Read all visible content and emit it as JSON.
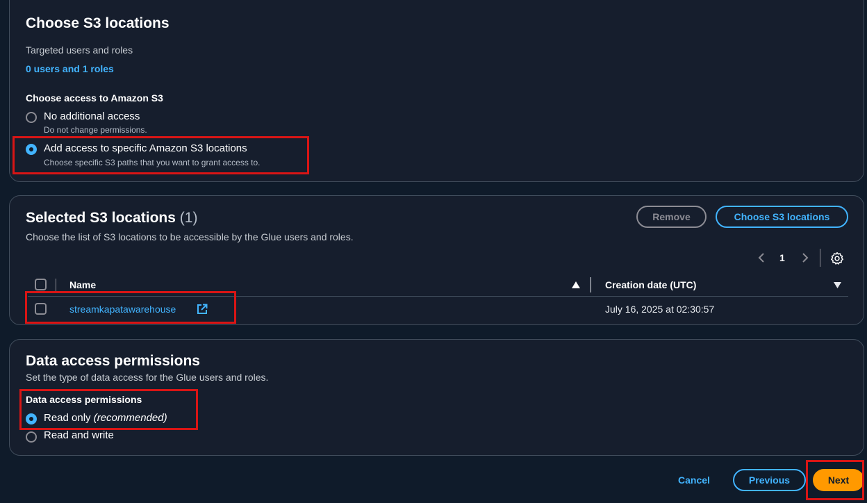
{
  "s3_access": {
    "title": "Choose S3 locations",
    "targeted_label": "Targeted users and roles",
    "targeted_link": "0 users and 1 roles",
    "access_label": "Choose access to Amazon S3",
    "options": [
      {
        "label": "No additional access",
        "description": "Do not change permissions.",
        "selected": false
      },
      {
        "label": "Add access to specific Amazon S3 locations",
        "description": "Choose specific S3 paths that you want to grant access to.",
        "selected": true
      }
    ]
  },
  "selected_locations": {
    "title": "Selected S3 locations",
    "count": "(1)",
    "description": "Choose the list of S3 locations to be accessible by the Glue users and roles.",
    "remove_label": "Remove",
    "choose_label": "Choose S3 locations",
    "pagination": {
      "current_page": "1"
    },
    "columns": {
      "name": "Name",
      "creation_date": "Creation date (UTC)"
    },
    "rows": [
      {
        "name": "streamkapatawarehouse",
        "creation_date": "July 16, 2025 at 02:30:57"
      }
    ]
  },
  "data_permissions": {
    "title": "Data access permissions",
    "description": "Set the type of data access for the Glue users and roles.",
    "group_label": "Data access permissions",
    "options": [
      {
        "label": "Read only",
        "note": "(recommended)",
        "selected": true
      },
      {
        "label": "Read and write",
        "selected": false
      }
    ]
  },
  "footer": {
    "cancel_label": "Cancel",
    "previous_label": "Previous",
    "next_label": "Next"
  },
  "colors": {
    "background": "#0f1b2a",
    "panel": "#161e2d",
    "accent": "#42b4ff",
    "primary_button": "#ff9900",
    "highlight": "#d91515"
  }
}
